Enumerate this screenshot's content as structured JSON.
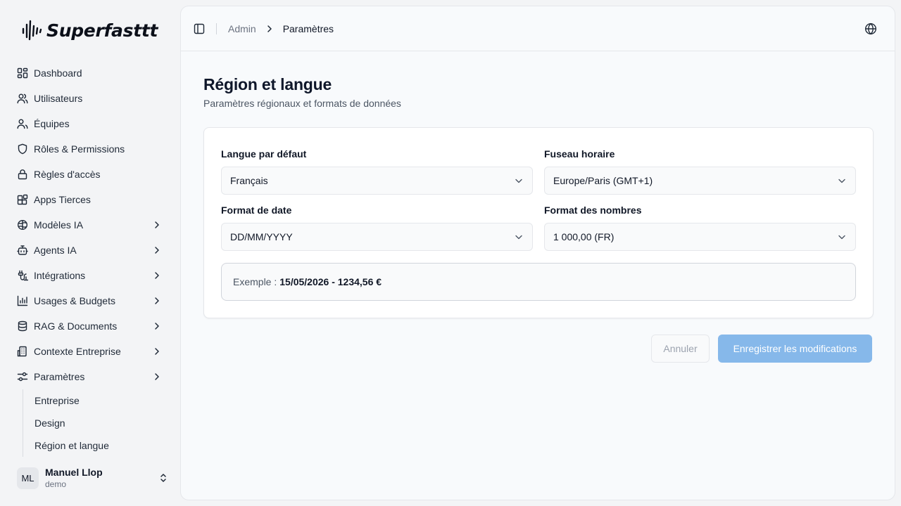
{
  "app": {
    "brand": "Superfasttt",
    "logo_icon": "sound-wave-icon"
  },
  "sidebar": {
    "items": [
      {
        "label": "Dashboard",
        "icon": "dashboard-icon",
        "has_chevron": false
      },
      {
        "label": "Utilisateurs",
        "icon": "users-icon",
        "has_chevron": false
      },
      {
        "label": "Équipes",
        "icon": "team-icon",
        "has_chevron": false
      },
      {
        "label": "Rôles & Permissions",
        "icon": "shield-icon",
        "has_chevron": false
      },
      {
        "label": "Règles d'accès",
        "icon": "lock-icon",
        "has_chevron": false
      },
      {
        "label": "Apps Tierces",
        "icon": "apps-icon",
        "has_chevron": false
      },
      {
        "label": "Modèles IA",
        "icon": "brain-icon",
        "has_chevron": true
      },
      {
        "label": "Agents IA",
        "icon": "bot-icon",
        "has_chevron": true
      },
      {
        "label": "Intégrations",
        "icon": "cable-icon",
        "has_chevron": true
      },
      {
        "label": "Usages & Budgets",
        "icon": "bar-chart-icon",
        "has_chevron": true
      },
      {
        "label": "RAG & Documents",
        "icon": "database-icon",
        "has_chevron": true
      },
      {
        "label": "Contexte Entreprise",
        "icon": "building-icon",
        "has_chevron": true
      },
      {
        "label": "Paramètres",
        "icon": "settings-sliders-icon",
        "has_chevron": true
      }
    ],
    "subitems": [
      {
        "label": "Entreprise"
      },
      {
        "label": "Design"
      },
      {
        "label": "Région et langue"
      }
    ],
    "user": {
      "initials": "ML",
      "name": "Manuel Llop",
      "role": "demo"
    }
  },
  "topbar": {
    "breadcrumb_parent": "Admin",
    "breadcrumb_current": "Paramètres"
  },
  "page": {
    "title": "Région et langue",
    "subtitle": "Paramètres régionaux et formats de données"
  },
  "form": {
    "language": {
      "label": "Langue par défaut",
      "value": "Français"
    },
    "timezone": {
      "label": "Fuseau horaire",
      "value": "Europe/Paris (GMT+1)"
    },
    "date_format": {
      "label": "Format de date",
      "value": "DD/MM/YYYY"
    },
    "number_format": {
      "label": "Format des nombres",
      "value": "1 000,00 (FR)"
    },
    "example_label": "Exemple :",
    "example_value": "15/05/2026 - 1234,56 €"
  },
  "actions": {
    "cancel": "Annuler",
    "save": "Enregistrer les modifications"
  },
  "colors": {
    "accent": "#86b8ea",
    "background": "#f3f4f6",
    "panel": "#f8fafc"
  }
}
